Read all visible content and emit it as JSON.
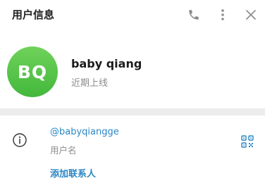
{
  "header": {
    "title": "用户信息",
    "icons": {
      "call": "phone-icon",
      "more": "more-vertical-icon",
      "close": "close-icon"
    }
  },
  "profile": {
    "initials": "BQ",
    "name": "baby qiang",
    "status": "近期上线",
    "avatar_color": "#55c346"
  },
  "info": {
    "username": "@babyqiangge",
    "username_label": "用户名",
    "add_contact": "添加联系人",
    "icons": {
      "info": "info-icon",
      "qr": "qr-code-icon"
    }
  },
  "colors": {
    "accent": "#2a87c6",
    "muted": "#8c8c8c",
    "divider": "#ececec"
  }
}
